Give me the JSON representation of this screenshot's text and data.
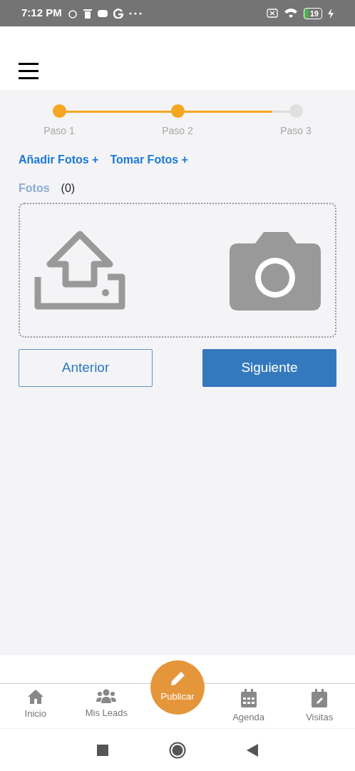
{
  "status_bar": {
    "time": "7:12 PM",
    "battery": "19"
  },
  "stepper": {
    "level": 0.9,
    "steps": [
      {
        "label": "Paso 1",
        "completed": true
      },
      {
        "label": "Paso 2",
        "completed": true
      },
      {
        "label": "Paso 3",
        "completed": false
      }
    ]
  },
  "photo_links": [
    "Añadir Fotos +",
    "Tomar Fotos +"
  ],
  "photos": {
    "label": "Fotos",
    "count": "(0)"
  },
  "buttons": [
    {
      "label": "Anterior",
      "kind": "outline"
    },
    {
      "label": "Siguiente",
      "kind": "primary"
    }
  ],
  "bottom_nav": [
    {
      "label": "Inicio",
      "kind": "home"
    },
    {
      "label": "Mis Leads",
      "kind": "users"
    },
    {
      "label": "Publicar",
      "kind": "fab"
    },
    {
      "label": "Agenda",
      "kind": "calendar"
    },
    {
      "label": "Visitas",
      "kind": "calendar-edit"
    }
  ]
}
